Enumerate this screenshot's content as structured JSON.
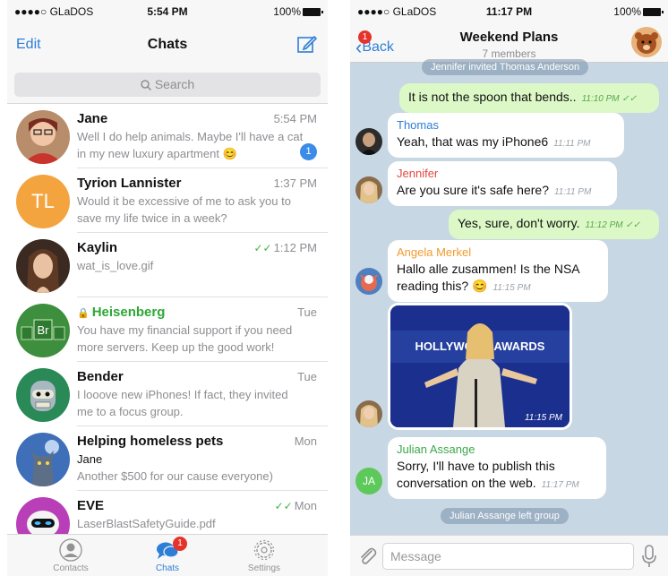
{
  "left": {
    "status": {
      "carrier": "●●●●○ GLaDOS",
      "time": "5:54 PM",
      "battery": "100%"
    },
    "nav": {
      "edit": "Edit",
      "title": "Chats"
    },
    "search": {
      "placeholder": "Search"
    },
    "chats": [
      {
        "name": "Jane",
        "time": "5:54 PM",
        "preview": "Well I do help animals. Maybe I'll have a cat in my new luxury apartment 😊",
        "unread": "1",
        "avatar": "photo"
      },
      {
        "name": "Tyrion Lannister",
        "time": "1:37 PM",
        "preview": "Would it be excessive of me to ask you to save my life twice in a week?",
        "initials": "TL"
      },
      {
        "name": "Kaylin",
        "time": "1:12 PM",
        "preview": "wat_is_love.gif",
        "read": true
      },
      {
        "name": "Heisenberg",
        "time": "Tue",
        "preview": "You have my financial support if you need more servers. Keep up the good work!",
        "secret": true,
        "avatar_text": "Br"
      },
      {
        "name": "Bender",
        "time": "Tue",
        "preview": "I looove new iPhones! If fact, they invited me to a focus group."
      },
      {
        "name": "Helping homeless pets",
        "time": "Mon",
        "sender": "Jane",
        "preview": "Another $500 for our cause everyone)"
      },
      {
        "name": "EVE",
        "time": "Mon",
        "preview": "LaserBlastSafetyGuide.pdf",
        "read": true
      }
    ],
    "tabs": {
      "contacts": "Contacts",
      "chats": "Chats",
      "settings": "Settings",
      "chats_badge": "1"
    }
  },
  "right": {
    "status": {
      "carrier": "●●●●○ GLaDOS",
      "time": "11:17 PM",
      "battery": "100%"
    },
    "nav": {
      "back": "Back",
      "back_badge": "1",
      "title": "Weekend Plans",
      "subtitle": "7 members"
    },
    "system_top": "Jennifer invited Thomas Anderson",
    "messages": [
      {
        "text": "It is not the spoon that bends..",
        "time": "11:10 PM"
      },
      {
        "sender": "Thomas",
        "text": "Yeah, that was my iPhone6",
        "time": "11:11 PM"
      },
      {
        "sender": "Jennifer",
        "text": "Are you sure it's safe here?",
        "time": "11:11 PM"
      },
      {
        "text": "Yes, sure, don't worry.",
        "time": "11:12 PM"
      },
      {
        "sender": "Angela Merkel",
        "text": "Hallo alle zusammen! Is the NSA reading this? 😊",
        "time": "11:15 PM"
      },
      {
        "photo_time": "11:15 PM",
        "photo_text": "HOLLYWOOD AWARDS"
      },
      {
        "sender": "Julian Assange",
        "text": "Sorry, I'll have to publish this conversation on the web.",
        "time": "11:17 PM",
        "initials": "JA"
      }
    ],
    "system_bottom": "Julian Assange left group",
    "input": {
      "placeholder": "Message"
    }
  },
  "colors": {
    "accent": "#2d7ed7",
    "outgoing": "#dcf8c6",
    "chat_bg": "#c8d7e4",
    "badge": "#e5332b",
    "secret": "#2ea834"
  }
}
